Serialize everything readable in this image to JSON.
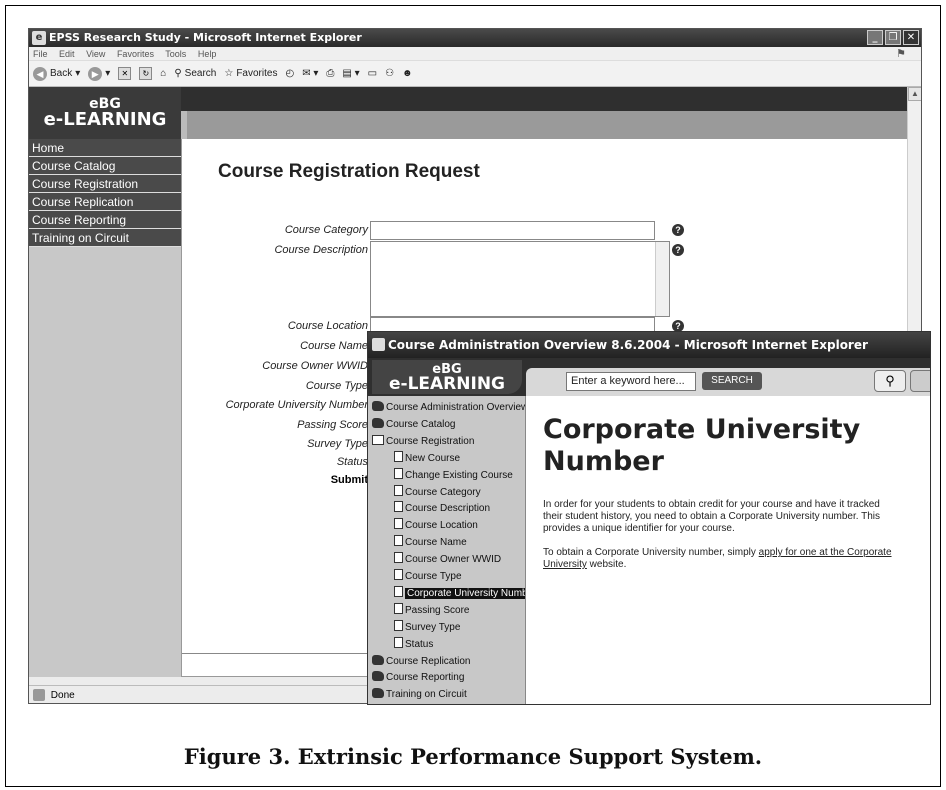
{
  "main_window": {
    "title": "EPSS Research Study - Microsoft Internet Explorer",
    "menu": [
      "File",
      "Edit",
      "View",
      "Favorites",
      "Tools",
      "Help"
    ],
    "toolbar": {
      "back": "Back",
      "search": "Search",
      "favorites": "Favorites"
    },
    "logo": {
      "line1": "eBG",
      "line2": "e-LEARNING"
    },
    "sidebar": [
      "Home",
      "Course Catalog",
      "Course Registration",
      "Course Replication",
      "Course Reporting",
      "Training on Circuit"
    ],
    "form": {
      "title": "Course Registration Request",
      "fields": [
        {
          "label": "Course Category"
        },
        {
          "label": "Course Description"
        },
        {
          "label": "Course Location"
        },
        {
          "label": "Course Name"
        },
        {
          "label": "Course Owner WWID"
        },
        {
          "label": "Course Type"
        },
        {
          "label": "Corporate University Number"
        },
        {
          "label": "Passing Score"
        },
        {
          "label": "Survey Type"
        },
        {
          "label": "Status"
        }
      ],
      "submit": "Submit"
    },
    "status": "Done"
  },
  "popup": {
    "title": "Course Administration Overview 8.6.2004 - Microsoft Internet Explorer",
    "logo": {
      "line1": "eBG",
      "line2": "e-LEARNING"
    },
    "search_placeholder": "Enter a keyword here...",
    "search_button": "SEARCH",
    "nav": [
      {
        "label": "Course Administration Overview",
        "kind": "top"
      },
      {
        "label": "Course Catalog",
        "kind": "top"
      },
      {
        "label": "Course Registration",
        "kind": "open"
      },
      {
        "label": "New Course",
        "kind": "sub"
      },
      {
        "label": "Change Existing Course",
        "kind": "sub"
      },
      {
        "label": "Course Category",
        "kind": "sub"
      },
      {
        "label": "Course Description",
        "kind": "sub"
      },
      {
        "label": "Course Location",
        "kind": "sub"
      },
      {
        "label": "Course Name",
        "kind": "sub"
      },
      {
        "label": "Course Owner WWID",
        "kind": "sub"
      },
      {
        "label": "Course Type",
        "kind": "sub"
      },
      {
        "label": "Corporate University Number",
        "kind": "sub-selected"
      },
      {
        "label": "Passing Score",
        "kind": "sub"
      },
      {
        "label": "Survey Type",
        "kind": "sub"
      },
      {
        "label": "Status",
        "kind": "sub"
      },
      {
        "label": "Course Replication",
        "kind": "top"
      },
      {
        "label": "Course Reporting",
        "kind": "top"
      },
      {
        "label": "Training on Circuit",
        "kind": "top"
      }
    ],
    "content": {
      "heading_line1": "Corporate University",
      "heading_line2": "Number",
      "p1_line1": "In order for your students to obtain credit for your course and have it tracked",
      "p1_line2": "their student history, you need to obtain a Corporate University number. This",
      "p1_line3": "provides a unique identifier for your course.",
      "p2_prefix": "To obtain a Corporate University number, simply ",
      "p2_link1": "apply for one at the Corporate",
      "p2_link2": "University",
      "p2_suffix": " website."
    }
  },
  "caption": "Figure 3. Extrinsic Performance Support System."
}
